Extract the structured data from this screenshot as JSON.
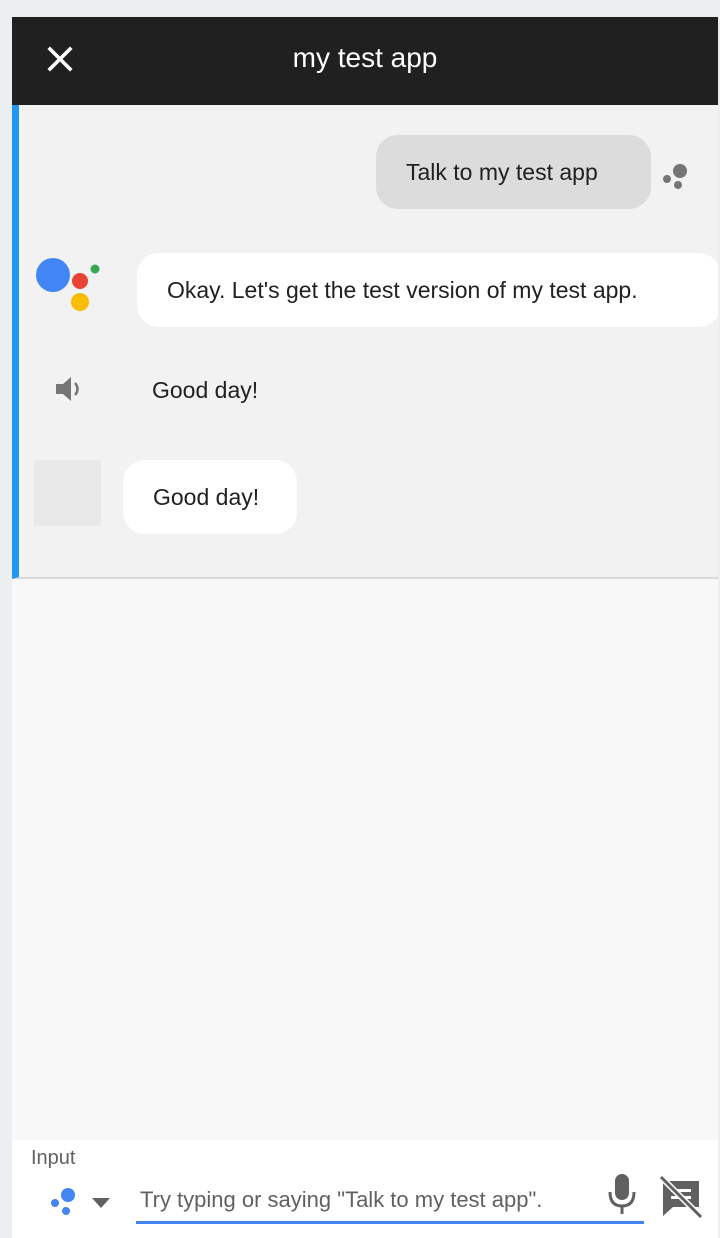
{
  "header": {
    "title": "my test app",
    "close_icon": "close-icon"
  },
  "conversation": {
    "accent_color": "#2196f3",
    "messages": [
      {
        "role": "user",
        "text": "Talk to my test app",
        "icon": "user-dots-icon"
      },
      {
        "role": "assistant",
        "text": "Okay. Let's get the test version of my test app.",
        "icon": "google-assistant-logo"
      },
      {
        "role": "app-speech",
        "text": "Good day!",
        "icon": "speaker-icon"
      },
      {
        "role": "app-bubble",
        "text": "Good day!"
      }
    ]
  },
  "input": {
    "label": "Input",
    "placeholder": "Try typing or saying \"Talk to my test app\".",
    "value": "",
    "mode_icon": "assistant-dots-icon",
    "mic_icon": "microphone-icon",
    "toggle_icon": "chat-off-icon",
    "underline_color": "#4285f4"
  }
}
